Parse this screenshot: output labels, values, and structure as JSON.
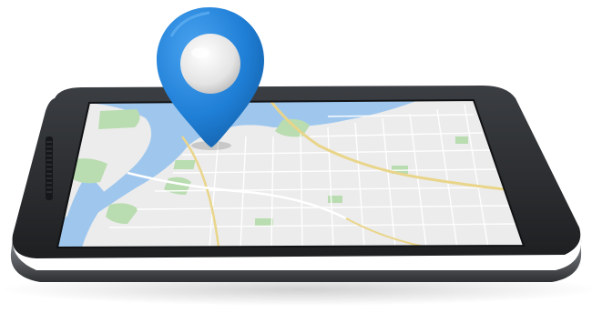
{
  "scene": {
    "subject": "smartphone-with-map-and-location-pin",
    "colors": {
      "background": "#ffffff",
      "phone_body": "#2f3134",
      "phone_edge": "#6b6e72",
      "map_land": "#ececec",
      "map_water": "#9fc7ee",
      "map_park": "#b9dcb0",
      "map_road_major": "#e9d58a",
      "map_road_minor": "#ffffff",
      "pin": "#1f7fd6",
      "pin_inner": "#f2f2f2"
    },
    "icons": [
      "location-pin-icon",
      "speaker-grille-icon"
    ]
  }
}
